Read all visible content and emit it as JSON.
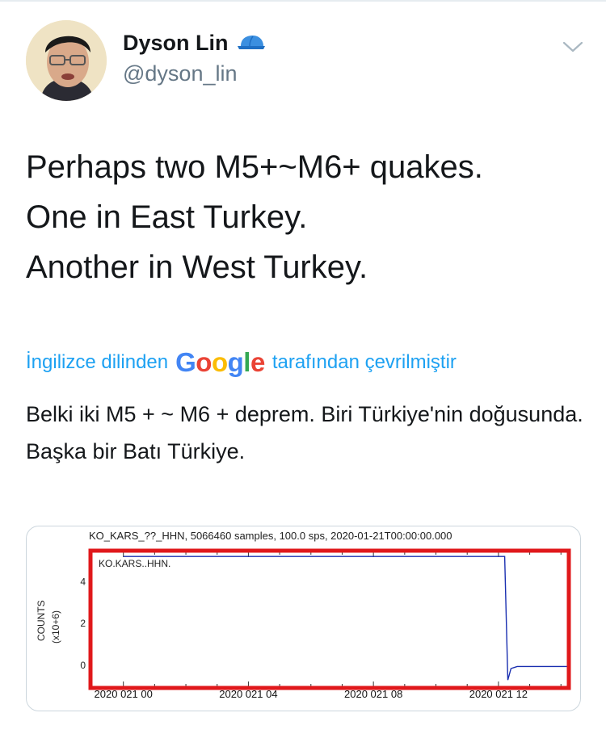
{
  "user": {
    "display_name": "Dyson Lin",
    "handle": "@dyson_lin",
    "badge_icon": "blue-cap-icon"
  },
  "tweet": {
    "lines": [
      "Perhaps two M5+~M6+ quakes.",
      "One in East Turkey.",
      "Another in West Turkey."
    ]
  },
  "translation": {
    "prefix": "İngilizce dilinden",
    "logo": "Google",
    "suffix": "tarafından çevrilmiştir",
    "text": "Belki iki M5 + ~ M6 + deprem. Biri Türkiye'nin doğusunda. Başka bir Batı Türkiye."
  },
  "colors": {
    "link_blue": "#1da1f2",
    "text": "#14171a",
    "secondary": "#657786",
    "highlight_red": "#e0181b",
    "trace_blue": "#1a2fb0"
  },
  "chart_data": {
    "type": "line",
    "title": "KO_KARS_??_HHN, 5066460 samples, 100.0 sps, 2020-01-21T00:00:00.000",
    "station_label": "KO.KARS..HHN.",
    "ylabel": "COUNTS",
    "ylabel_unit": "(x10+6)",
    "yticks": [
      "4",
      "2",
      "0"
    ],
    "xticks": [
      "2020 021 00",
      "2020 021 04",
      "2020 021 08",
      "2020 021 12"
    ],
    "series": [
      {
        "x_hours": [
          0,
          12.2,
          12.3,
          12.4,
          12.6,
          13.5,
          14.2
        ],
        "values": [
          5.2,
          5.2,
          -0.7,
          -0.15,
          -0.05,
          -0.05,
          -0.05
        ]
      }
    ],
    "xlim_hours": [
      -1,
      14.2
    ],
    "ylim": [
      -1,
      5.4
    ],
    "annotation": "red rectangle highlighting the plot area"
  }
}
